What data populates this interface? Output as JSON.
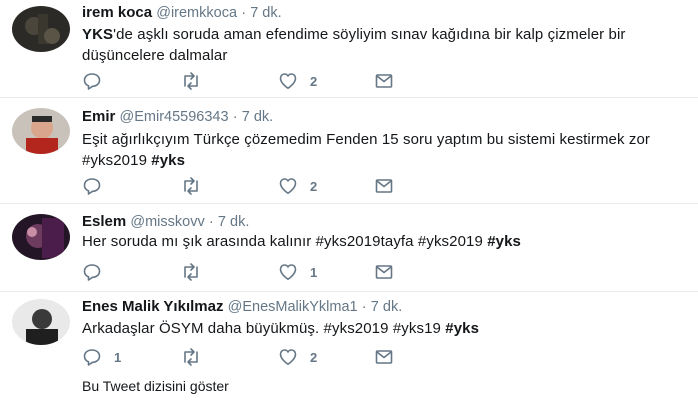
{
  "tweets": [
    {
      "name": "irem koca",
      "handle": "@iremkkoca",
      "dot": "·",
      "time": "7 dk.",
      "text_parts": [
        "YKS",
        "'de aşklı soruda aman efendime söyliyim sınav kağıdına bir kalp çizmeler bir düşüncelere dalmalar"
      ],
      "reply_count": "",
      "retweet_count": "",
      "like_count": "2"
    },
    {
      "name": "Emir",
      "handle": "@Emir45596343",
      "dot": "·",
      "time": "7 dk.",
      "text_parts": [
        "Eşit ağırlıkçıyım Türkçe çözemedim Fenden 15 soru yaptım bu sistemi kestirmek zor ",
        "#yks2019",
        " ",
        "#yks"
      ],
      "reply_count": "",
      "retweet_count": "",
      "like_count": "2"
    },
    {
      "name": "Eslem",
      "handle": "@misskovv",
      "dot": "·",
      "time": "7 dk.",
      "text_parts": [
        "Her soruda mı şık arasında kalınır ",
        "#yks2019tayfa",
        " ",
        "#yks2019",
        " ",
        "#yks"
      ],
      "reply_count": "",
      "retweet_count": "",
      "like_count": "1"
    },
    {
      "name": "Enes Malik Yıkılmaz",
      "handle": "@EnesMalikYklma1",
      "dot": "·",
      "time": "7 dk.",
      "text_parts": [
        "Arkadaşlar ÖSYM daha büyükmüş. ",
        "#yks2019",
        " ",
        "#yks19",
        " ",
        "#yks"
      ],
      "reply_count": "1",
      "retweet_count": "",
      "like_count": "2"
    }
  ],
  "show_thread": "Bu Tweet dizisini göster",
  "icons": {
    "reply": "reply-icon",
    "retweet": "retweet-icon",
    "like": "heart-icon",
    "dm": "envelope-icon",
    "more": "chevron-down-icon"
  },
  "colors": {
    "text": "#14171a",
    "muted": "#657786",
    "border": "#e6ecf0"
  }
}
